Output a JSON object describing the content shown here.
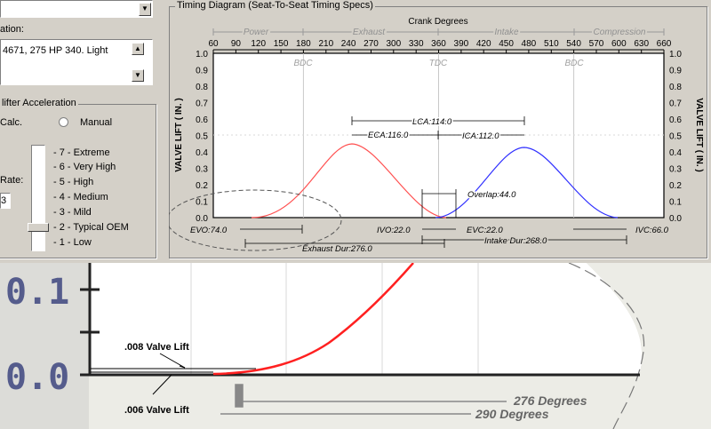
{
  "left_panel": {
    "combo_label_partial": "ation:",
    "engine_desc": "4671, 275 HP 340. Light",
    "accel_group_title": "lifter Acceleration",
    "calc_label": "Calc.",
    "manual_label": "Manual",
    "rate_label": "Rate:",
    "rate_value": "3",
    "levels": [
      "- 7 -  Extreme",
      "- 6 -  Very High",
      "- 5 -  High",
      "- 4 -  Medium",
      "- 3 -  Mild",
      "- 2 -  Typical OEM",
      "- 1 -  Low"
    ],
    "selected_level": 2
  },
  "timing": {
    "group_title": "Timing Diagram (Seat-To-Seat Timing Specs)",
    "crank_title": "Crank Degrees",
    "y_axis_label": "VALVE LIFT ( IN. )",
    "y_ticks": [
      "1.0",
      "0.9",
      "0.8",
      "0.7",
      "0.6",
      "0.5",
      "0.4",
      "0.3",
      "0.2",
      "0.1",
      "0.0"
    ],
    "x_ticks": [
      "60",
      "90",
      "120",
      "150",
      "180",
      "210",
      "240",
      "270",
      "300",
      "330",
      "360",
      "390",
      "420",
      "450",
      "480",
      "510",
      "540",
      "570",
      "600",
      "630",
      "660"
    ],
    "phases": [
      "Power",
      "Exhaust",
      "Intake",
      "Compression"
    ],
    "markers": [
      "BDC",
      "TDC",
      "BDC"
    ],
    "annotations": {
      "lca": "LCA:114.0",
      "eca": "ECA:116.0",
      "ica": "ICA:112.0",
      "overlap": "Overlap:44.0",
      "evo": "EVO:74.0",
      "ivo": "IVO:22.0",
      "evc": "EVC:22.0",
      "ivc": "IVC:66.0",
      "exhaust_dur": "Exhaust Dur:276.0",
      "intake_dur": "Intake Dur:268.0"
    },
    "colors": {
      "exhaust": "#ff5050",
      "intake": "#3030ff"
    }
  },
  "zoom": {
    "tick_top": "0.1",
    "tick_bottom": "0.0",
    "lift_008": ".008 Valve Lift",
    "lift_006": ".006 Valve Lift",
    "deg_276": "276 Degrees",
    "deg_290": "290 Degrees"
  }
}
